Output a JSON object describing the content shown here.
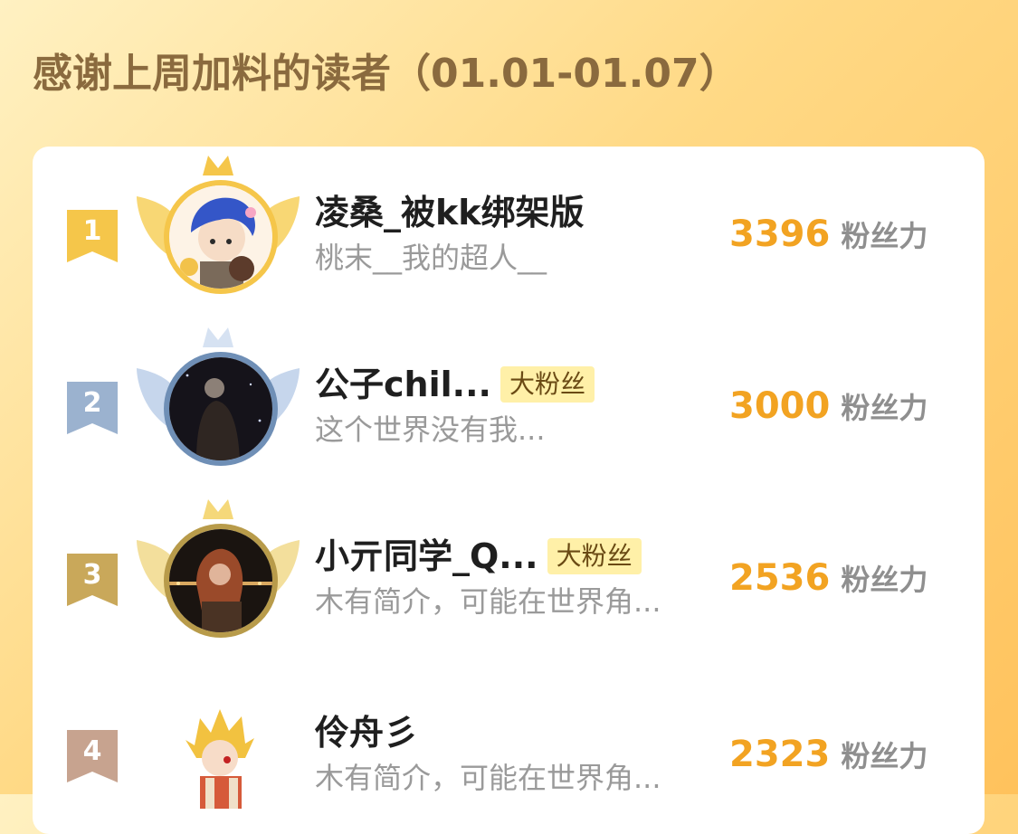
{
  "header": {
    "title": "感谢上周加料的读者（01.01-01.07）"
  },
  "colors": {
    "gold": "#f5c64a",
    "silver": "#9bb2cf",
    "bronze": "#c9a85a",
    "fourth": "#c7a38f",
    "score": "#f2a322",
    "title": "#8a6a3e",
    "badge_bg": "#fff0a8"
  },
  "ranking": {
    "unit_label": "粉丝力",
    "entries": [
      {
        "rank": "1",
        "name": "凌桑_被kk绑架版",
        "badge": "",
        "bio": "桃末__我的超人__",
        "score": "3396",
        "avatar_icon": "anime-boy-blue-hair-avatar"
      },
      {
        "rank": "2",
        "name": "公子chil...",
        "badge": "大粉丝",
        "bio": "这个世界没有我...",
        "score": "3000",
        "avatar_icon": "night-photo-avatar"
      },
      {
        "rank": "3",
        "name": "小亓同学_Q...",
        "badge": "大粉丝",
        "bio": "木有简介，可能在世界角...",
        "score": "2536",
        "avatar_icon": "girl-red-hair-night-avatar"
      },
      {
        "rank": "4",
        "name": "伶舟彡",
        "badge": "",
        "bio": "木有简介，可能在世界角...",
        "score": "2323",
        "avatar_icon": "chibi-blond-character-avatar"
      }
    ]
  }
}
